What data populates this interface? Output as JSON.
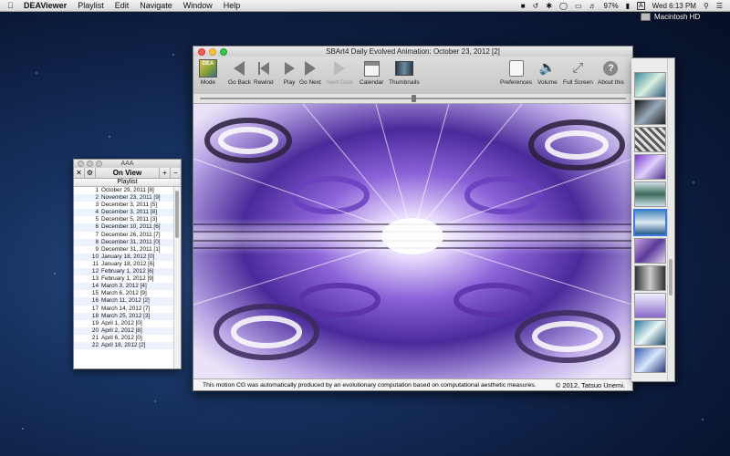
{
  "menubar": {
    "apple_icon": "apple-icon",
    "app_name": "DEAViewer",
    "menus": [
      "Playlist",
      "Edit",
      "Navigate",
      "Window",
      "Help"
    ],
    "battery": "97%",
    "input_source": "A",
    "clock": "Wed 6:13 PM"
  },
  "desktop": {
    "disk_label": "Macintosh HD"
  },
  "playlist_window": {
    "title": "AAA",
    "header": "On View",
    "column_header": "Playlist",
    "rows": [
      {
        "n": "1",
        "label": "October 29, 2011 [8]"
      },
      {
        "n": "2",
        "label": "November 23, 2011 [9]"
      },
      {
        "n": "3",
        "label": "December 3, 2011 [5]"
      },
      {
        "n": "4",
        "label": "December 3, 2011 [8]"
      },
      {
        "n": "5",
        "label": "December 5, 2011 [3]"
      },
      {
        "n": "6",
        "label": "December 10, 2011 [6]"
      },
      {
        "n": "7",
        "label": "December 26, 2011 [7]"
      },
      {
        "n": "8",
        "label": "December 31, 2011 [0]"
      },
      {
        "n": "9",
        "label": "December 31, 2011 [1]"
      },
      {
        "n": "10",
        "label": "January 18, 2012 [0]"
      },
      {
        "n": "11",
        "label": "January 18, 2012 [6]"
      },
      {
        "n": "12",
        "label": "February 1, 2012 [6]"
      },
      {
        "n": "13",
        "label": "February 1, 2012 [9]"
      },
      {
        "n": "14",
        "label": "March 3, 2012 [4]"
      },
      {
        "n": "15",
        "label": "March 6, 2012 [9]"
      },
      {
        "n": "16",
        "label": "March 11, 2012 [2]"
      },
      {
        "n": "17",
        "label": "March 14, 2012 [7]"
      },
      {
        "n": "18",
        "label": "March 25, 2012 [3]"
      },
      {
        "n": "19",
        "label": "April 1, 2012 [0]"
      },
      {
        "n": "20",
        "label": "April 2, 2012 [8]"
      },
      {
        "n": "21",
        "label": "April 6, 2012 [0]"
      },
      {
        "n": "22",
        "label": "April 18, 2012 [2]"
      }
    ]
  },
  "main_window": {
    "title": "SBArt4 Daily Evolved Animation: October 23, 2012 [2]",
    "toolbar": {
      "mode": "Mode",
      "go_back": "Go Back",
      "rewind": "Rewind",
      "play": "Play",
      "go_next": "Go Next",
      "next_date": "Next Date",
      "calendar": "Calendar",
      "thumbnails": "Thumbnails",
      "preferences": "Preferences",
      "volume": "Volume",
      "full_screen": "Full Screen",
      "about": "About this"
    },
    "mode_icon_text": "DEA",
    "progress": 0.5,
    "footer_text": "This motion CG was automatically produced by an evolutionary computation based on computational aesthetic measures.",
    "copyright": "© 2012, Tatsuo Unemi."
  },
  "colors": {
    "accent": "#3b7be0",
    "art_purple": "#6a3fc0",
    "art_white": "#f4f0ff"
  }
}
